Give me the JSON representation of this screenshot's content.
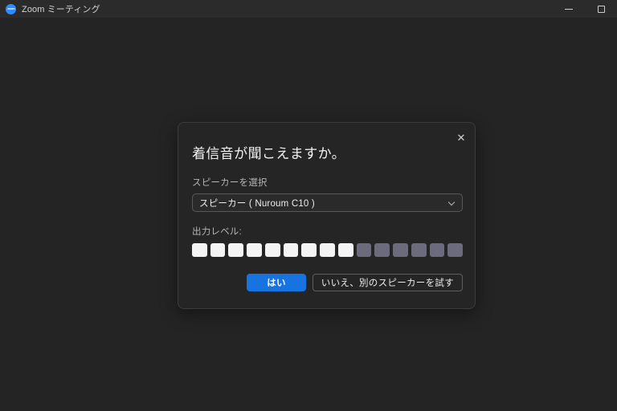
{
  "window": {
    "title": "Zoom ミーティング",
    "logo_icon": "zoom-logo-icon",
    "logo_text": "zoom",
    "controls": {
      "minimize_icon": "minimize-icon",
      "maximize_icon": "maximize-icon"
    },
    "background_color": "#242424",
    "titlebar_color": "#2b2b2b"
  },
  "dialog": {
    "title": "着信音が聞こえますか。",
    "close_icon": "close-icon",
    "close_glyph": "✕",
    "speaker": {
      "label": "スピーカーを選択",
      "selected": "スピーカー ( Nuroum C10 )",
      "chevron_icon": "chevron-down-icon"
    },
    "output_level": {
      "label": "出力レベル:",
      "total_segments": 15,
      "filled_segments": 9,
      "filled_color": "#f4f4f4",
      "empty_color": "#6b6b7d"
    },
    "buttons": {
      "primary": "はい",
      "secondary": "いいえ、別のスピーカーを試す",
      "primary_color": "#1673e0"
    }
  }
}
